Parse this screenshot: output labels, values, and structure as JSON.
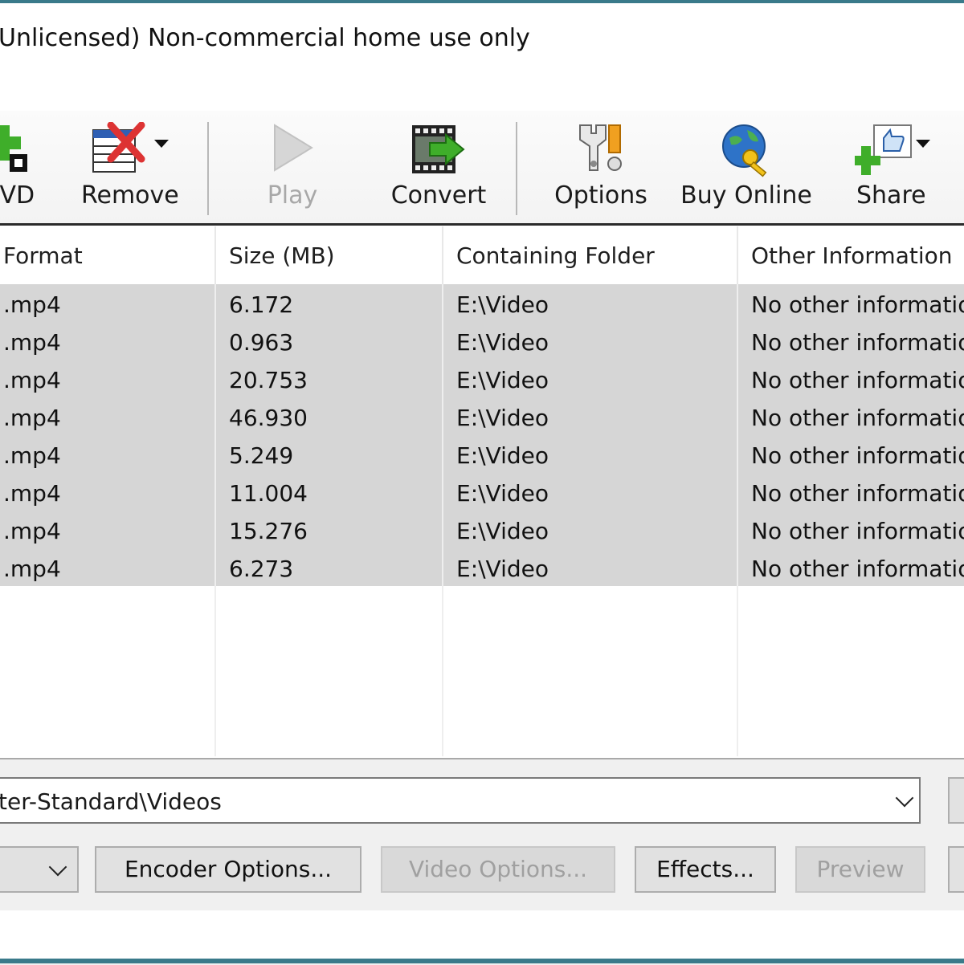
{
  "title": "Unlicensed) Non-commercial home use only",
  "toolbar": {
    "items": [
      {
        "label": "DVD",
        "icon": "add-dvd-icon",
        "enabled": true
      },
      {
        "label": "Remove",
        "icon": "remove-list-icon",
        "enabled": true
      },
      {
        "label": "Play",
        "icon": "play-icon",
        "enabled": false
      },
      {
        "label": "Convert",
        "icon": "convert-film-icon",
        "enabled": true
      },
      {
        "label": "Options",
        "icon": "options-tools-icon",
        "enabled": true
      },
      {
        "label": "Buy Online",
        "icon": "buy-online-globe-key-icon",
        "enabled": true
      },
      {
        "label": "Share",
        "icon": "share-thumbs-up-icon",
        "enabled": true
      }
    ]
  },
  "file_list": {
    "columns": [
      "Format",
      "Size (MB)",
      "Containing Folder",
      "Other Information"
    ],
    "rows": [
      {
        "format": ".mp4",
        "size": "6.172",
        "folder": "E:\\Video",
        "info": "No other information"
      },
      {
        "format": ".mp4",
        "size": "0.963",
        "folder": "E:\\Video",
        "info": "No other information"
      },
      {
        "format": ".mp4",
        "size": "20.753",
        "folder": "E:\\Video",
        "info": "No other information"
      },
      {
        "format": ".mp4",
        "size": "46.930",
        "folder": "E:\\Video",
        "info": "No other information"
      },
      {
        "format": ".mp4",
        "size": "5.249",
        "folder": "E:\\Video",
        "info": "No other information"
      },
      {
        "format": ".mp4",
        "size": "11.004",
        "folder": "E:\\Video",
        "info": "No other information"
      },
      {
        "format": ".mp4",
        "size": "15.276",
        "folder": "E:\\Video",
        "info": "No other information"
      },
      {
        "format": ".mp4",
        "size": "6.273",
        "folder": "E:\\Video",
        "info": "No other information"
      }
    ]
  },
  "output": {
    "folder_value": "ter-Standard\\Videos"
  },
  "buttons": {
    "encoder_options": "Encoder Options...",
    "video_options": "Video Options...",
    "effects": "Effects...",
    "preview": "Preview"
  },
  "colors": {
    "window_border": "#3a7a8a",
    "row_highlight": "#d6d6d6",
    "convert_green": "#3fae2a"
  }
}
